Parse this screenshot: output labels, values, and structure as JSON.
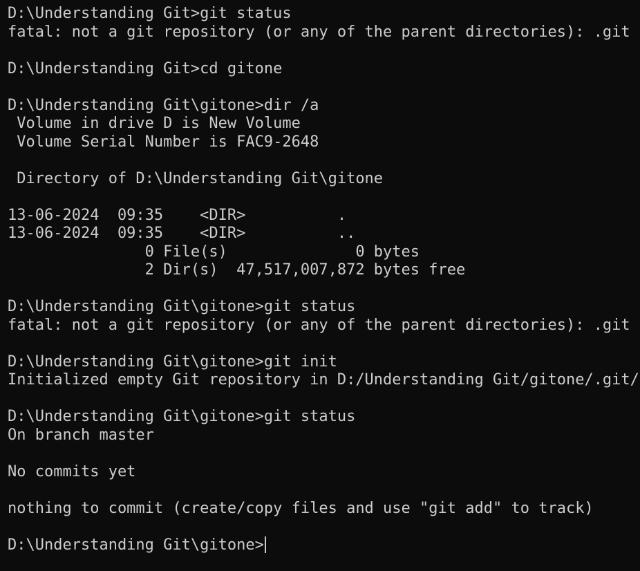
{
  "terminal": {
    "lines": [
      "D:\\Understanding Git>git status",
      "fatal: not a git repository (or any of the parent directories): .git",
      "",
      "D:\\Understanding Git>cd gitone",
      "",
      "D:\\Understanding Git\\gitone>dir /a",
      " Volume in drive D is New Volume",
      " Volume Serial Number is FAC9-2648",
      "",
      " Directory of D:\\Understanding Git\\gitone",
      "",
      "13-06-2024  09:35    <DIR>          .",
      "13-06-2024  09:35    <DIR>          ..",
      "               0 File(s)              0 bytes",
      "               2 Dir(s)  47,517,007,872 bytes free",
      "",
      "D:\\Understanding Git\\gitone>git status",
      "fatal: not a git repository (or any of the parent directories): .git",
      "",
      "D:\\Understanding Git\\gitone>git init",
      "Initialized empty Git repository in D:/Understanding Git/gitone/.git/",
      "",
      "D:\\Understanding Git\\gitone>git status",
      "On branch master",
      "",
      "No commits yet",
      "",
      "nothing to commit (create/copy files and use \"git add\" to track)",
      ""
    ],
    "prompt": "D:\\Understanding Git\\gitone>",
    "colors": {
      "background": "#0c0c0c",
      "foreground": "#cccccc"
    }
  }
}
